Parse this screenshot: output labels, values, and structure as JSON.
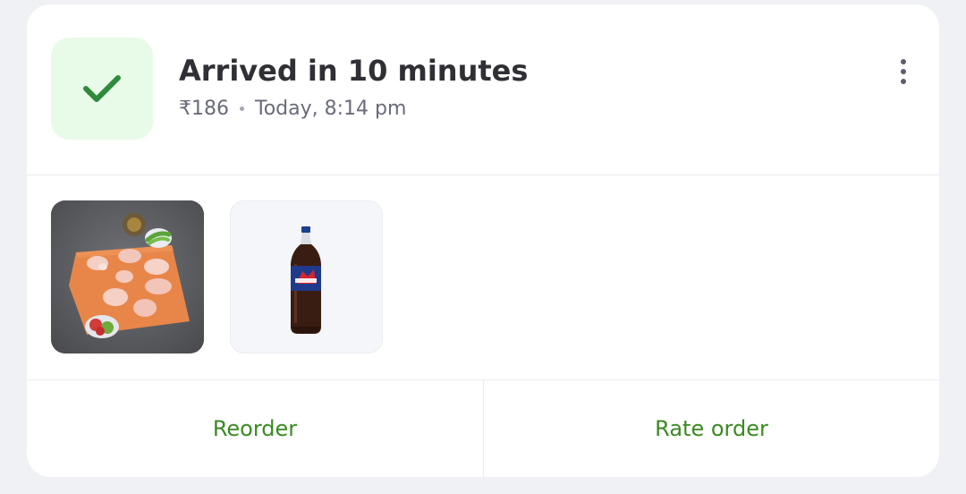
{
  "order": {
    "title": "Arrived in 10 minutes",
    "amount": "₹186",
    "time": "Today, 8:14 pm",
    "status_icon": "checkmark-icon",
    "menu_icon": "more-vertical-icon"
  },
  "items": [
    {
      "name": "chicken-curry-cut-image"
    },
    {
      "name": "cola-bottle-image"
    }
  ],
  "actions": {
    "reorder_label": "Reorder",
    "rate_label": "Rate order"
  },
  "colors": {
    "accent_green": "#3a8b21",
    "check_green": "#2e8b3a",
    "status_bg": "#e8fbe9"
  }
}
